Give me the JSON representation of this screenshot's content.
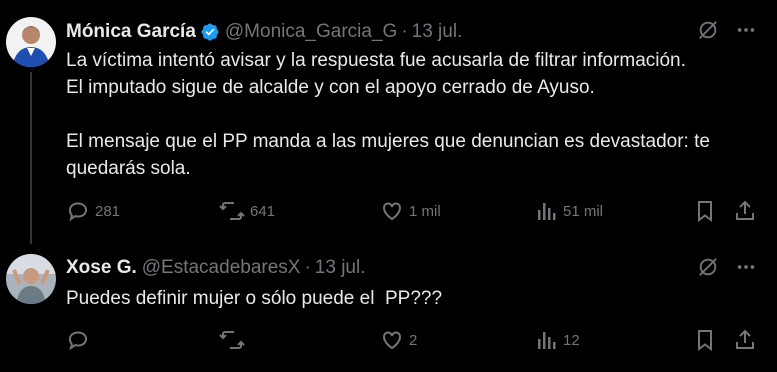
{
  "tweets": [
    {
      "author_name": "Mónica García",
      "handle": "@Monica_Garcia_G",
      "separator": "·",
      "date": "13 jul.",
      "text": "La víctima intentó avisar y la respuesta fue acusarla de filtrar información.\nEl imputado sigue de alcalde y con el apoyo cerrado de Ayuso.\n\nEl mensaje que el PP manda a las mujeres que denuncian es devastador: te\nquedarás sola.",
      "replies": "281",
      "reposts": "641",
      "likes": "1 mil",
      "views": "51 mil"
    },
    {
      "author_name": "Xose G.",
      "handle": "@EstacadebaresX",
      "separator": "·",
      "date": "13 jul.",
      "text": "Puedes definir mujer o sólo puede el  PP???",
      "replies": "",
      "reposts": "",
      "likes": "2",
      "views": "12"
    }
  ],
  "colors": {
    "background": "#000000",
    "text": "#e7e9ea",
    "muted": "#71767b",
    "verified": "#1d9bf0"
  },
  "icons": [
    "verified-badge-icon",
    "grok-icon",
    "more-icon",
    "reply-icon",
    "repost-icon",
    "like-icon",
    "views-icon",
    "bookmark-icon",
    "share-icon"
  ]
}
